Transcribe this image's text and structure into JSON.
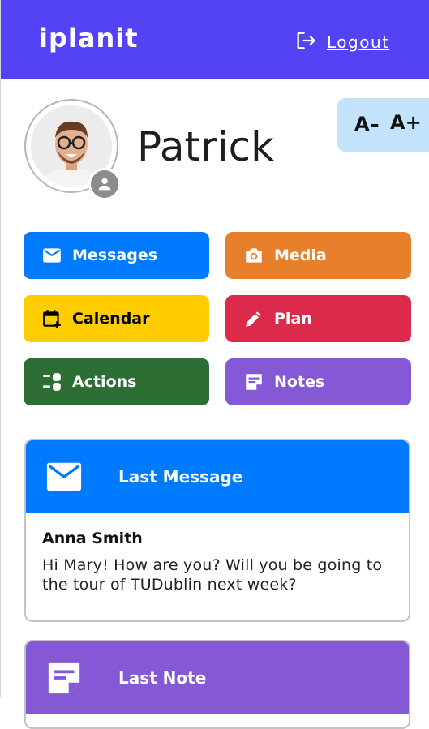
{
  "header": {
    "brand": "iplanit",
    "logout_label": "Logout"
  },
  "profile": {
    "name": "Patrick"
  },
  "font_size": {
    "decrease_label": "A–",
    "increase_label": "A+"
  },
  "nav": [
    {
      "label": "Messages",
      "icon": "mail-icon",
      "color": "#007bff",
      "text_color": "#ffffff"
    },
    {
      "label": "Media",
      "icon": "camera-icon",
      "color": "#e87f2a",
      "text_color": "#ffffff"
    },
    {
      "label": "Calendar",
      "icon": "calendar-add-icon",
      "color": "#ffcc00",
      "text_color": "#000000"
    },
    {
      "label": "Plan",
      "icon": "pencil-icon",
      "color": "#dc2a4a",
      "text_color": "#ffffff"
    },
    {
      "label": "Actions",
      "icon": "actions-icon",
      "color": "#2c6e33",
      "text_color": "#ffffff"
    },
    {
      "label": "Notes",
      "icon": "note-icon",
      "color": "#8558d6",
      "text_color": "#ffffff"
    }
  ],
  "last_message": {
    "title": "Last Message",
    "sender": "Anna Smith",
    "text": "Hi Mary! How are you? Will you be going to the tour of TUDublin next week?",
    "color": "#007bff"
  },
  "last_note": {
    "title": "Last Note",
    "color": "#8558d6"
  }
}
